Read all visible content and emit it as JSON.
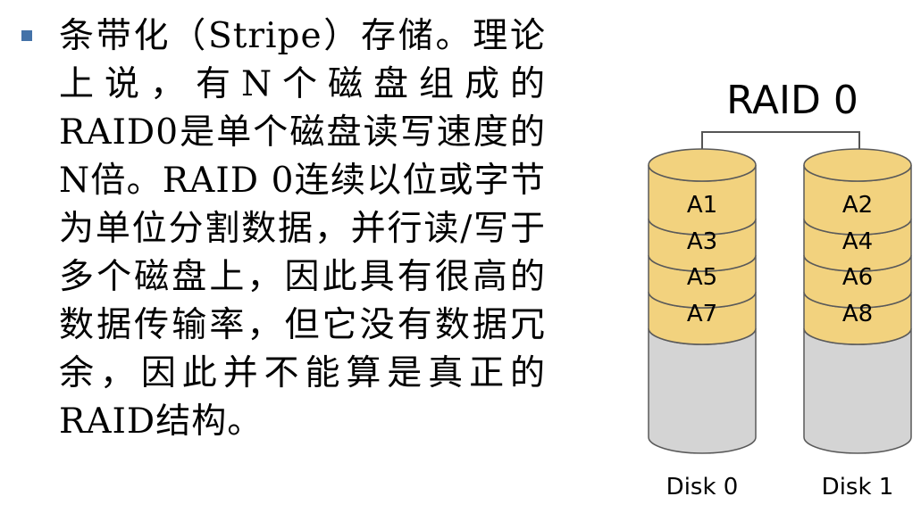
{
  "slide": {
    "bullet_text": "条带化（Stripe）存储。理论上说，有N个磁盘组成的RAID0是单个磁盘读写速度的N倍。RAID 0连续以位或字节为单位分割数据，并行读/写于多个磁盘上，因此具有很高的数据传输率，但它没有数据冗余，因此并不能算是真正的RAID结构。"
  },
  "diagram": {
    "title": "RAID 0",
    "disks": [
      {
        "label": "Disk 0",
        "blocks": [
          "A1",
          "A3",
          "A5",
          "A7"
        ]
      },
      {
        "label": "Disk 1",
        "blocks": [
          "A2",
          "A4",
          "A6",
          "A8"
        ]
      }
    ],
    "colors": {
      "data_block": "#f2d27e",
      "empty": "#d4d4d4",
      "stroke": "#5a5a5a"
    }
  }
}
